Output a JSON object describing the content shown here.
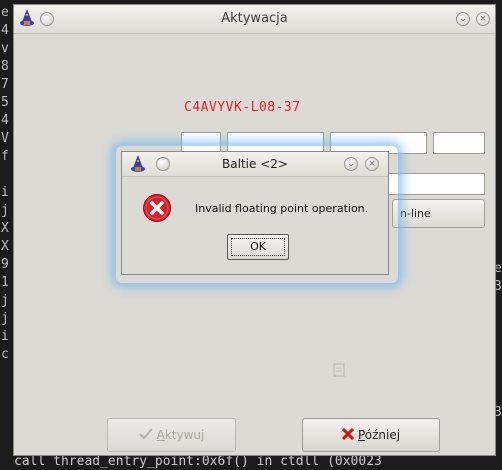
{
  "terminal": {
    "left_chars": [
      "e",
      "4",
      "v",
      "8",
      "7",
      "5",
      "4",
      "V",
      "f",
      "",
      "i",
      "j",
      "X",
      "X",
      "9",
      "1",
      "j",
      "j",
      "i",
      "c"
    ],
    "right_chars": [
      "e",
      "3",
      "",
      "",
      "",
      "",
      "",
      "",
      "3"
    ],
    "bottom_line": "call thread_entry_point:0x6f() in ctdll (0x0023"
  },
  "main_window": {
    "title": "Aktywacja",
    "code": "C4AVYVK-L08-37",
    "online_button_label": "n-line",
    "activate_button": {
      "label_prefix": "",
      "underline": "A",
      "label_rest": "ktywuj",
      "icon": "check-icon"
    },
    "later_button": {
      "underline": "P",
      "label_rest": "óźniej",
      "icon": "cross-icon"
    },
    "colors": {
      "code": "#e8212a",
      "background": "#dcdad5"
    }
  },
  "dialog": {
    "title": "Baltie <2>",
    "message": "Invalid floating point operation.",
    "ok_label": "OK",
    "icon": "error-icon",
    "colors": {
      "error": "#d8202a",
      "glow": "#78b9f0"
    }
  }
}
